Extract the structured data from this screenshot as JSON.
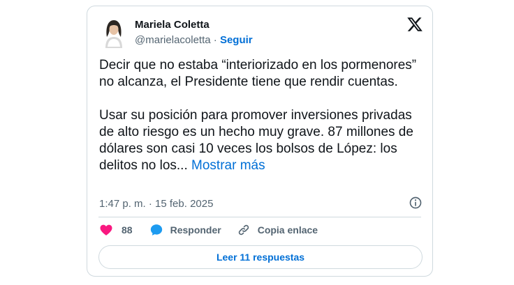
{
  "author": {
    "name": "Mariela Coletta",
    "handle": "@marielacoletta",
    "separator": "·",
    "follow_label": "Seguir"
  },
  "tweet": {
    "paragraph_1": "Decir que no estaba “interiorizado en los pormenores” no alcanza, el Presidente tiene que rendir cuentas.",
    "paragraph_2": "Usar su posición para promover inversiones privadas de alto riesgo es un hecho muy grave. 87 millones de dólares son casi 10 veces los bolsos de López: los delitos no los...",
    "show_more": "Mostrar más",
    "timestamp": "1:47 p. m. · 15 feb. 2025"
  },
  "actions": {
    "like_count": "88",
    "reply_label": "Responder",
    "copy_link_label": "Copia enlace"
  },
  "read_replies_label": "Leer 11 respuestas",
  "colors": {
    "accent": "#006fd6",
    "like": "#f91880",
    "reply_icon": "#1d9bf0",
    "secondary_text": "#536471",
    "border": "#cfd9de"
  },
  "icons": {
    "brand": "x-logo-icon",
    "like": "heart-icon",
    "reply": "speech-bubble-icon",
    "copy": "link-icon",
    "info": "info-icon"
  }
}
